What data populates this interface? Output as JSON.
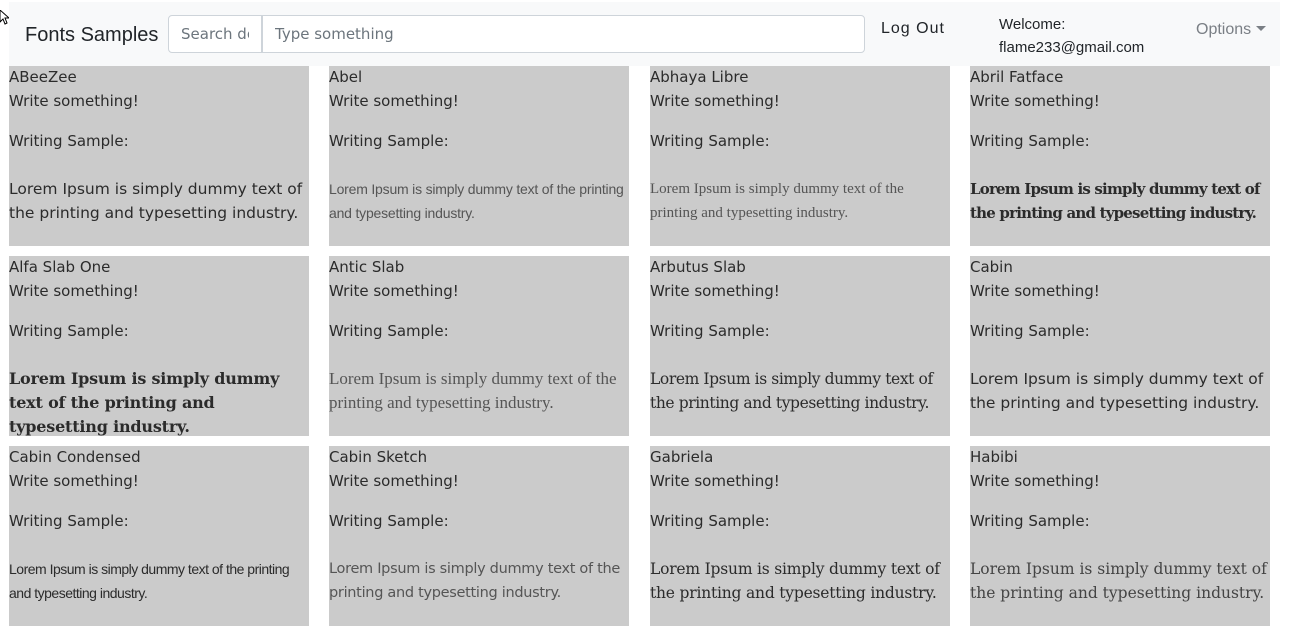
{
  "navbar": {
    "brand": "Fonts Samples",
    "search_docs_placeholder": "Search dc",
    "search_placeholder": "Type something",
    "logout_label": "Log Out",
    "welcome_label": "Welcome:",
    "user_email": "flame233@gmail.com",
    "options_label": "Options"
  },
  "card_labels": {
    "write_prompt": "Write something!",
    "sample_label": "Writing Sample:"
  },
  "sample_text": "Lorem Ipsum is simply dummy text of the printing and typesetting industry.",
  "fonts": [
    {
      "name": "ABeeZee"
    },
    {
      "name": "Abel"
    },
    {
      "name": "Abhaya Libre"
    },
    {
      "name": "Abril Fatface"
    },
    {
      "name": "Alfa Slab One"
    },
    {
      "name": "Antic Slab"
    },
    {
      "name": "Arbutus Slab"
    },
    {
      "name": "Cabin"
    },
    {
      "name": "Cabin Condensed"
    },
    {
      "name": "Cabin Sketch"
    },
    {
      "name": "Gabriela"
    },
    {
      "name": "Habibi"
    }
  ],
  "colors": {
    "card_bg": "#cbcbcb",
    "navbar_bg": "#f8f9fa"
  }
}
